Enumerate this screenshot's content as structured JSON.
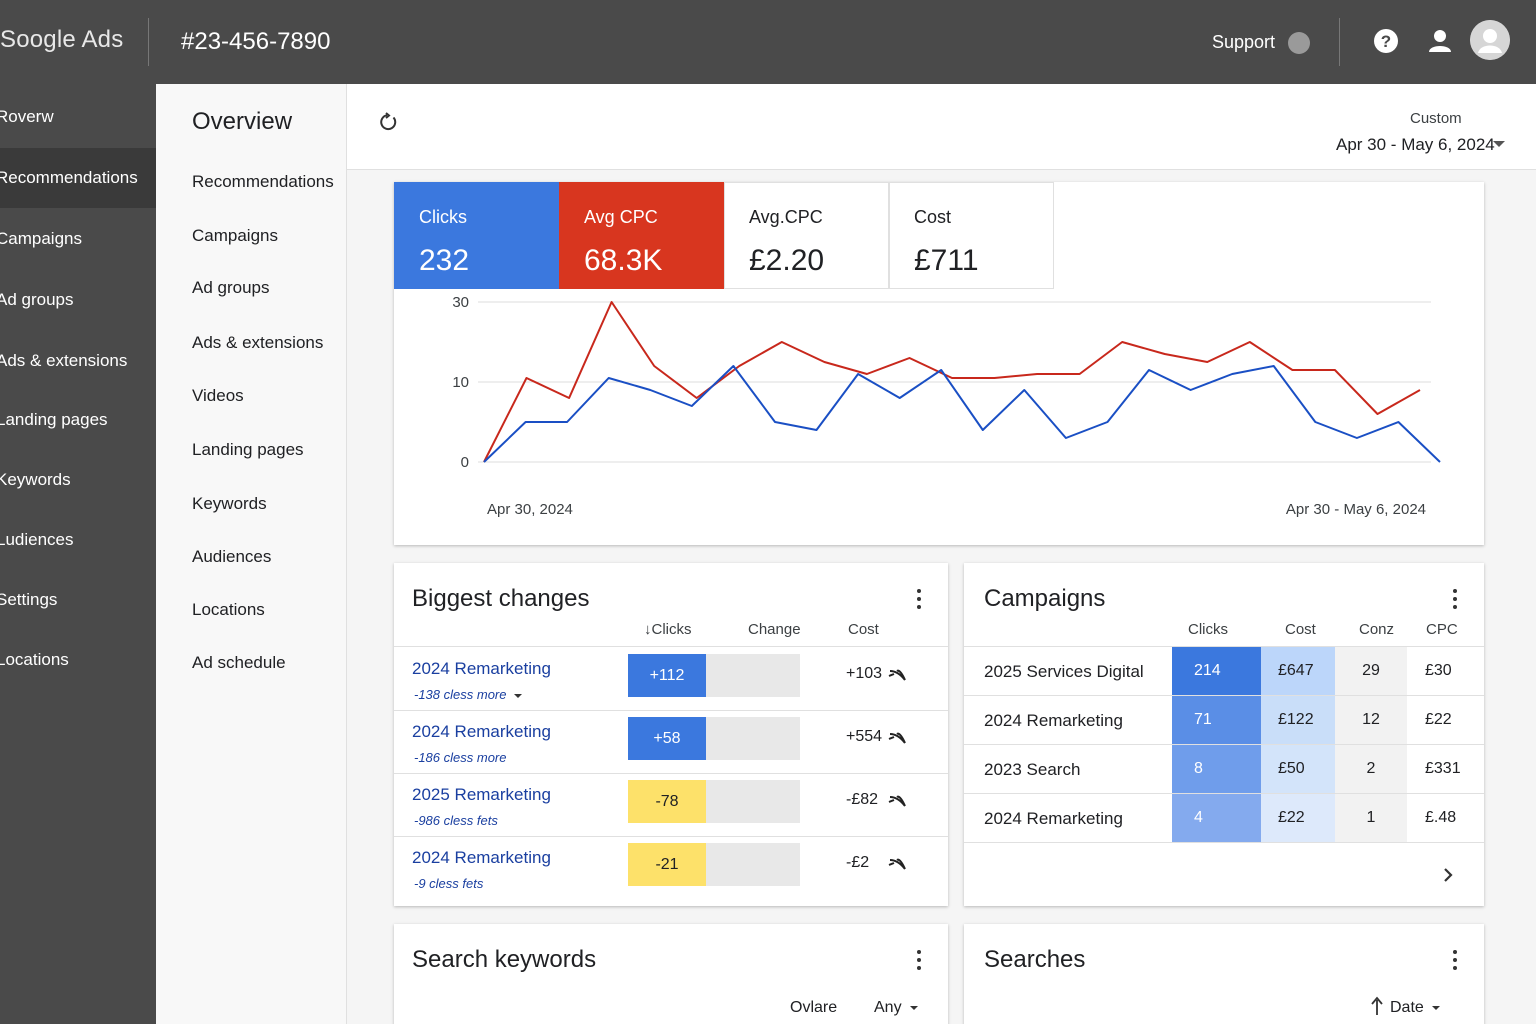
{
  "app": {
    "logo": "Soogle Ads",
    "account_id": "#23-456-7890"
  },
  "topbar": {
    "support_label": "Support",
    "icons": [
      "help-icon",
      "person-icon",
      "avatar"
    ]
  },
  "leftnav": {
    "items": [
      {
        "label": "Roverw",
        "active": false
      },
      {
        "label": "Recommendations",
        "active": true
      },
      {
        "label": "Campaigns",
        "active": false
      },
      {
        "label": "Ad groups",
        "active": false
      },
      {
        "label": "Ads & extensions",
        "active": false
      },
      {
        "label": "Landing pages",
        "active": false
      },
      {
        "label": "Keywords",
        "active": false
      },
      {
        "label": "Ludiences",
        "active": false
      },
      {
        "label": "Settings",
        "active": false
      },
      {
        "label": "Locations",
        "active": false
      }
    ]
  },
  "subnav": {
    "title": "Overview",
    "items": [
      "Recommendations",
      "Campaigns",
      "Ad groups",
      "Ads & extensions",
      "Videos",
      "Landing pages",
      "Keywords",
      "Audiences",
      "Locations",
      "Ad schedule"
    ]
  },
  "header": {
    "range_label": "Custom",
    "range_value": "Apr 30 - May 6, 2024"
  },
  "metrics": [
    {
      "label": "Clicks",
      "value": "232",
      "color": "#3b78de"
    },
    {
      "label": "Avg CPC",
      "value": "68.3K",
      "color": "#d8361f"
    },
    {
      "label": "Avg.CPC",
      "value": "£2.20",
      "color": "#ffffff"
    },
    {
      "label": "Cost",
      "value": "£711",
      "color": "#ffffff"
    }
  ],
  "chart_data": {
    "type": "line",
    "x_start_label": "Apr 30, 2024",
    "x_end_label": "Apr 30 - May 6, 2024",
    "y_ticks": [
      "30",
      "10",
      "0"
    ],
    "grid": true,
    "series": [
      {
        "color": "#c8281c",
        "values": [
          0,
          11,
          8,
          30,
          14,
          8,
          14,
          20,
          15,
          12,
          16,
          11,
          11,
          12,
          12,
          20,
          17,
          15,
          20,
          13,
          13,
          6,
          9
        ]
      },
      {
        "color": "#1a4fc4",
        "values": [
          0,
          5,
          5,
          11,
          9,
          7,
          14,
          5,
          4,
          12,
          8,
          13,
          4,
          9,
          3,
          5,
          13,
          9,
          12,
          14,
          5,
          3,
          5,
          0
        ]
      }
    ]
  },
  "biggest_changes": {
    "title": "Biggest changes",
    "columns": [
      "↓Clicks",
      "Change",
      "Cost"
    ],
    "rows": [
      {
        "name": "2024 Remarketing",
        "sub": "-138 cless more",
        "has_caret": true,
        "change": "+112",
        "change_color": "#3b78de",
        "cost": "+103"
      },
      {
        "name": "2024 Remarketing",
        "sub": "-186 cless more",
        "has_caret": false,
        "change": "+58",
        "change_color": "#3b78de",
        "cost": "+554"
      },
      {
        "name": "2025 Remarketing",
        "sub": "-986 cless fets",
        "has_caret": false,
        "change": "-78",
        "change_color": "#fde16a",
        "cost": "-£82"
      },
      {
        "name": "2024 Remarketing",
        "sub": "-9 cless fets",
        "has_caret": false,
        "change": "-21",
        "change_color": "#fde16a",
        "cost": "-£2"
      }
    ]
  },
  "campaigns": {
    "title": "Campaigns",
    "columns": [
      "Clicks",
      "Cost",
      "Conz",
      "CPC"
    ],
    "rows": [
      {
        "name": "2025 Services Digital",
        "clicks": "214",
        "cost": "£647",
        "conv": "29",
        "cpc": "£30"
      },
      {
        "name": "2024 Remarketing",
        "clicks": "71",
        "cost": "£122",
        "conv": "12",
        "cpc": "£22"
      },
      {
        "name": "2023 Search",
        "clicks": "8",
        "cost": "£50",
        "conv": "2",
        "cpc": "£331"
      },
      {
        "name": "2024 Remarketing",
        "clicks": "4",
        "cost": "£22",
        "conv": "1",
        "cpc": "£.48"
      }
    ]
  },
  "search_keywords": {
    "title": "Search keywords",
    "control_a": "Ovlare",
    "control_b": "Any"
  },
  "searches": {
    "title": "Searches",
    "control": "Date"
  }
}
